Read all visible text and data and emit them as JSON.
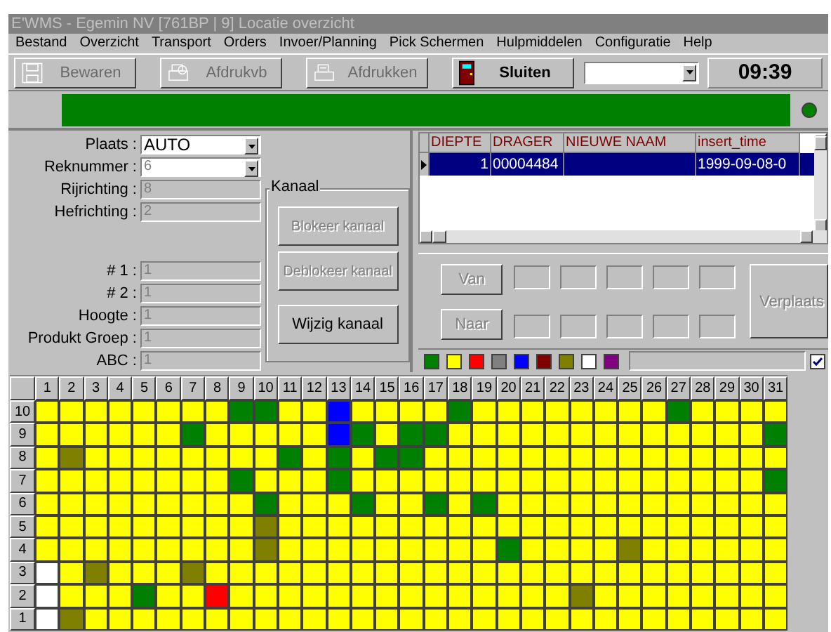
{
  "window": {
    "title": "E'WMS - Egemin NV [761BP | 9] Locatie overzicht"
  },
  "menu": [
    "Bestand",
    "Overzicht",
    "Transport",
    "Orders",
    "Invoer/Planning",
    "Pick Schermen",
    "Hulpmiddelen",
    "Configuratie",
    "Help"
  ],
  "toolbar": [
    {
      "kind": "save",
      "label": "Bewaren",
      "disabled": true
    },
    {
      "kind": "preview",
      "label": "Afdrukvb",
      "disabled": true
    },
    {
      "kind": "print",
      "label": "Afdrukken",
      "disabled": true
    },
    {
      "kind": "exit",
      "label": "Sluiten",
      "disabled": false
    }
  ],
  "clock": "09:39",
  "fields_top": [
    {
      "kind": "dropdown",
      "label": "Plaats :",
      "value": "AUTO",
      "disabled": false
    },
    {
      "kind": "dropdown",
      "label": "Reknummer :",
      "value": "6",
      "disabled": true
    },
    {
      "kind": "text",
      "label": "Rijrichting :",
      "value": "8",
      "disabled": true
    },
    {
      "kind": "text",
      "label": "Hefrichting :",
      "value": "2",
      "disabled": true
    }
  ],
  "fields_bottom": [
    {
      "kind": "text",
      "label": "# 1 :",
      "value": "1",
      "disabled": true
    },
    {
      "kind": "text",
      "label": "# 2 :",
      "value": "1",
      "disabled": true
    },
    {
      "kind": "text",
      "label": "Hoogte :",
      "value": "1",
      "disabled": true
    },
    {
      "kind": "text",
      "label": "Produkt Groep :",
      "value": "1",
      "disabled": true
    },
    {
      "kind": "text",
      "label": "ABC :",
      "value": "1",
      "disabled": true
    }
  ],
  "kanaal": {
    "title": "Kanaal",
    "buttons": [
      {
        "label": "Blokeer kanaal",
        "disabled": true
      },
      {
        "label": "Deblokeer kanaal",
        "disabled": true
      },
      {
        "label": "Wijzig kanaal",
        "disabled": false
      }
    ]
  },
  "table": {
    "columns": [
      "DIEPTE",
      "DRAGER",
      "NIEUWE NAAM",
      "insert_time"
    ],
    "rows": [
      {
        "selected": true,
        "diepte": "1",
        "drager": "00004484",
        "insert_time": "1999-09-08-0"
      }
    ]
  },
  "move": {
    "van": {
      "label": "Van",
      "disabled": true
    },
    "naar": {
      "label": "Naar",
      "disabled": true
    },
    "verplaats": {
      "label": "Verplaats",
      "disabled": true
    }
  },
  "legend": [
    {
      "color": "#008000"
    },
    {
      "color": "#ffff00"
    },
    {
      "color": "#ff0000"
    },
    {
      "color": "#808080"
    },
    {
      "color": "#0000ff"
    },
    {
      "color": "#800000"
    },
    {
      "color": "#808000"
    },
    {
      "color": "#ffffff"
    },
    {
      "color": "#800080"
    }
  ],
  "legend_checkbox": {
    "checked": true
  },
  "grid": {
    "columns": [
      "1",
      "2",
      "3",
      "4",
      "5",
      "6",
      "7",
      "8",
      "9",
      "10",
      "11",
      "12",
      "13",
      "14",
      "15",
      "16",
      "17",
      "18",
      "19",
      "20",
      "21",
      "22",
      "23",
      "24",
      "25",
      "26",
      "27",
      "28",
      "29",
      "30",
      "31"
    ],
    "rows": [
      {
        "label": "10",
        "cells": [
          {
            "color": "#ffff00"
          },
          {
            "color": "#ffff00"
          },
          {
            "color": "#ffff00"
          },
          {
            "color": "#ffff00"
          },
          {
            "color": "#ffff00"
          },
          {
            "color": "#ffff00"
          },
          {
            "color": "#ffff00"
          },
          {
            "color": "#ffff00"
          },
          {
            "color": "#008000"
          },
          {
            "color": "#008000"
          },
          {
            "color": "#ffff00"
          },
          {
            "color": "#ffff00"
          },
          {
            "color": "#0000ff"
          },
          {
            "color": "#ffff00"
          },
          {
            "color": "#ffff00"
          },
          {
            "color": "#ffff00"
          },
          {
            "color": "#ffff00"
          },
          {
            "color": "#008000"
          },
          {
            "color": "#ffff00"
          },
          {
            "color": "#ffff00"
          },
          {
            "color": "#ffff00"
          },
          {
            "color": "#ffff00"
          },
          {
            "color": "#ffff00"
          },
          {
            "color": "#ffff00"
          },
          {
            "color": "#ffff00"
          },
          {
            "color": "#ffff00"
          },
          {
            "color": "#008000"
          },
          {
            "color": "#ffff00"
          },
          {
            "color": "#ffff00"
          },
          {
            "color": "#ffff00"
          },
          {
            "color": "#ffff00"
          }
        ]
      },
      {
        "label": "9",
        "cells": [
          {
            "color": "#ffff00"
          },
          {
            "color": "#ffff00"
          },
          {
            "color": "#ffff00"
          },
          {
            "color": "#ffff00"
          },
          {
            "color": "#ffff00"
          },
          {
            "color": "#ffff00"
          },
          {
            "color": "#008000"
          },
          {
            "color": "#ffff00"
          },
          {
            "color": "#ffff00"
          },
          {
            "color": "#ffff00"
          },
          {
            "color": "#ffff00"
          },
          {
            "color": "#ffff00"
          },
          {
            "color": "#0000ff"
          },
          {
            "color": "#008000"
          },
          {
            "color": "#ffff00"
          },
          {
            "color": "#008000"
          },
          {
            "color": "#008000"
          },
          {
            "color": "#ffff00"
          },
          {
            "color": "#ffff00"
          },
          {
            "color": "#ffff00"
          },
          {
            "color": "#ffff00"
          },
          {
            "color": "#ffff00"
          },
          {
            "color": "#ffff00"
          },
          {
            "color": "#ffff00"
          },
          {
            "color": "#ffff00"
          },
          {
            "color": "#ffff00"
          },
          {
            "color": "#ffff00"
          },
          {
            "color": "#ffff00"
          },
          {
            "color": "#ffff00"
          },
          {
            "color": "#ffff00"
          },
          {
            "color": "#008000"
          }
        ]
      },
      {
        "label": "8",
        "cells": [
          {
            "color": "#ffff00"
          },
          {
            "color": "#808000"
          },
          {
            "color": "#ffff00"
          },
          {
            "color": "#ffff00"
          },
          {
            "color": "#ffff00"
          },
          {
            "color": "#ffff00"
          },
          {
            "color": "#ffff00"
          },
          {
            "color": "#ffff00"
          },
          {
            "color": "#ffff00"
          },
          {
            "color": "#ffff00"
          },
          {
            "color": "#008000"
          },
          {
            "color": "#ffff00"
          },
          {
            "color": "#008000"
          },
          {
            "color": "#ffff00"
          },
          {
            "color": "#008000"
          },
          {
            "color": "#008000"
          },
          {
            "color": "#ffff00"
          },
          {
            "color": "#ffff00"
          },
          {
            "color": "#ffff00"
          },
          {
            "color": "#ffff00"
          },
          {
            "color": "#ffff00"
          },
          {
            "color": "#ffff00"
          },
          {
            "color": "#ffff00"
          },
          {
            "color": "#ffff00"
          },
          {
            "color": "#ffff00"
          },
          {
            "color": "#ffff00"
          },
          {
            "color": "#ffff00"
          },
          {
            "color": "#ffff00"
          },
          {
            "color": "#ffff00"
          },
          {
            "color": "#ffff00"
          },
          {
            "color": "#ffff00"
          }
        ]
      },
      {
        "label": "7",
        "cells": [
          {
            "color": "#ffff00"
          },
          {
            "color": "#ffff00"
          },
          {
            "color": "#ffff00"
          },
          {
            "color": "#ffff00"
          },
          {
            "color": "#ffff00"
          },
          {
            "color": "#ffff00"
          },
          {
            "color": "#ffff00"
          },
          {
            "color": "#ffff00"
          },
          {
            "color": "#008000"
          },
          {
            "color": "#ffff00"
          },
          {
            "color": "#ffff00"
          },
          {
            "color": "#ffff00"
          },
          {
            "color": "#008000"
          },
          {
            "color": "#ffff00"
          },
          {
            "color": "#ffff00"
          },
          {
            "color": "#ffff00"
          },
          {
            "color": "#ffff00"
          },
          {
            "color": "#ffff00"
          },
          {
            "color": "#ffff00"
          },
          {
            "color": "#ffff00"
          },
          {
            "color": "#ffff00"
          },
          {
            "color": "#ffff00"
          },
          {
            "color": "#ffff00"
          },
          {
            "color": "#ffff00"
          },
          {
            "color": "#ffff00"
          },
          {
            "color": "#ffff00"
          },
          {
            "color": "#ffff00"
          },
          {
            "color": "#ffff00"
          },
          {
            "color": "#ffff00"
          },
          {
            "color": "#ffff00"
          },
          {
            "color": "#008000"
          }
        ]
      },
      {
        "label": "6",
        "cells": [
          {
            "color": "#ffff00"
          },
          {
            "color": "#ffff00"
          },
          {
            "color": "#ffff00"
          },
          {
            "color": "#ffff00"
          },
          {
            "color": "#ffff00"
          },
          {
            "color": "#ffff00"
          },
          {
            "color": "#ffff00"
          },
          {
            "color": "#ffff00"
          },
          {
            "color": "#ffff00"
          },
          {
            "color": "#008000"
          },
          {
            "color": "#ffff00"
          },
          {
            "color": "#ffff00"
          },
          {
            "color": "#ffff00"
          },
          {
            "color": "#008000"
          },
          {
            "color": "#ffff00"
          },
          {
            "color": "#ffff00"
          },
          {
            "color": "#008000"
          },
          {
            "color": "#ffff00"
          },
          {
            "color": "#008000"
          },
          {
            "color": "#ffff00"
          },
          {
            "color": "#ffff00"
          },
          {
            "color": "#ffff00"
          },
          {
            "color": "#ffff00"
          },
          {
            "color": "#ffff00"
          },
          {
            "color": "#ffff00"
          },
          {
            "color": "#ffff00"
          },
          {
            "color": "#ffff00"
          },
          {
            "color": "#ffff00"
          },
          {
            "color": "#ffff00"
          },
          {
            "color": "#ffff00"
          },
          {
            "color": "#ffff00"
          }
        ]
      },
      {
        "label": "5",
        "cells": [
          {
            "color": "#ffff00"
          },
          {
            "color": "#ffff00"
          },
          {
            "color": "#ffff00"
          },
          {
            "color": "#ffff00"
          },
          {
            "color": "#ffff00"
          },
          {
            "color": "#ffff00"
          },
          {
            "color": "#ffff00"
          },
          {
            "color": "#ffff00"
          },
          {
            "color": "#ffff00"
          },
          {
            "color": "#808000"
          },
          {
            "color": "#ffff00"
          },
          {
            "color": "#ffff00"
          },
          {
            "color": "#ffff00"
          },
          {
            "color": "#ffff00"
          },
          {
            "color": "#ffff00"
          },
          {
            "color": "#ffff00"
          },
          {
            "color": "#ffff00"
          },
          {
            "color": "#ffff00"
          },
          {
            "color": "#ffff00"
          },
          {
            "color": "#ffff00"
          },
          {
            "color": "#ffff00"
          },
          {
            "color": "#ffff00"
          },
          {
            "color": "#ffff00"
          },
          {
            "color": "#ffff00"
          },
          {
            "color": "#ffff00"
          },
          {
            "color": "#ffff00"
          },
          {
            "color": "#ffff00"
          },
          {
            "color": "#ffff00"
          },
          {
            "color": "#ffff00"
          },
          {
            "color": "#ffff00"
          },
          {
            "color": "#ffff00"
          }
        ]
      },
      {
        "label": "4",
        "cells": [
          {
            "color": "#ffff00"
          },
          {
            "color": "#ffff00"
          },
          {
            "color": "#ffff00"
          },
          {
            "color": "#ffff00"
          },
          {
            "color": "#ffff00"
          },
          {
            "color": "#ffff00"
          },
          {
            "color": "#ffff00"
          },
          {
            "color": "#ffff00"
          },
          {
            "color": "#ffff00"
          },
          {
            "color": "#808000"
          },
          {
            "color": "#ffff00"
          },
          {
            "color": "#ffff00"
          },
          {
            "color": "#ffff00"
          },
          {
            "color": "#ffff00"
          },
          {
            "color": "#ffff00"
          },
          {
            "color": "#ffff00"
          },
          {
            "color": "#ffff00"
          },
          {
            "color": "#ffff00"
          },
          {
            "color": "#ffff00"
          },
          {
            "color": "#008000"
          },
          {
            "color": "#ffff00"
          },
          {
            "color": "#ffff00"
          },
          {
            "color": "#ffff00"
          },
          {
            "color": "#ffff00"
          },
          {
            "color": "#808000"
          },
          {
            "color": "#ffff00"
          },
          {
            "color": "#ffff00"
          },
          {
            "color": "#ffff00"
          },
          {
            "color": "#ffff00"
          },
          {
            "color": "#ffff00"
          },
          {
            "color": "#ffff00"
          }
        ]
      },
      {
        "label": "3",
        "cells": [
          {
            "color": "#ffffff"
          },
          {
            "color": "#ffff00"
          },
          {
            "color": "#808000"
          },
          {
            "color": "#ffff00"
          },
          {
            "color": "#ffff00"
          },
          {
            "color": "#ffff00"
          },
          {
            "color": "#808000"
          },
          {
            "color": "#ffff00"
          },
          {
            "color": "#ffff00"
          },
          {
            "color": "#ffff00"
          },
          {
            "color": "#ffff00"
          },
          {
            "color": "#ffff00"
          },
          {
            "color": "#ffff00"
          },
          {
            "color": "#ffff00"
          },
          {
            "color": "#ffff00"
          },
          {
            "color": "#ffff00"
          },
          {
            "color": "#ffff00"
          },
          {
            "color": "#ffff00"
          },
          {
            "color": "#ffff00"
          },
          {
            "color": "#ffff00"
          },
          {
            "color": "#ffff00"
          },
          {
            "color": "#ffff00"
          },
          {
            "color": "#ffff00"
          },
          {
            "color": "#ffff00"
          },
          {
            "color": "#ffff00"
          },
          {
            "color": "#ffff00"
          },
          {
            "color": "#ffff00"
          },
          {
            "color": "#ffff00"
          },
          {
            "color": "#ffff00"
          },
          {
            "color": "#ffff00"
          },
          {
            "color": "#ffff00"
          }
        ]
      },
      {
        "label": "2",
        "cells": [
          {
            "color": "#ffffff"
          },
          {
            "color": "#ffff00"
          },
          {
            "color": "#ffff00"
          },
          {
            "color": "#ffff00"
          },
          {
            "color": "#008000"
          },
          {
            "color": "#ffff00"
          },
          {
            "color": "#ffff00"
          },
          {
            "color": "#ff0000"
          },
          {
            "color": "#ffff00"
          },
          {
            "color": "#ffff00"
          },
          {
            "color": "#ffff00"
          },
          {
            "color": "#ffff00"
          },
          {
            "color": "#ffff00"
          },
          {
            "color": "#ffff00"
          },
          {
            "color": "#ffff00"
          },
          {
            "color": "#ffff00"
          },
          {
            "color": "#ffff00"
          },
          {
            "color": "#ffff00"
          },
          {
            "color": "#ffff00"
          },
          {
            "color": "#ffff00"
          },
          {
            "color": "#ffff00"
          },
          {
            "color": "#ffff00"
          },
          {
            "color": "#808000"
          },
          {
            "color": "#ffff00"
          },
          {
            "color": "#ffff00"
          },
          {
            "color": "#ffff00"
          },
          {
            "color": "#ffff00"
          },
          {
            "color": "#ffff00"
          },
          {
            "color": "#ffff00"
          },
          {
            "color": "#ffff00"
          },
          {
            "color": "#ffff00"
          }
        ]
      },
      {
        "label": "1",
        "cells": [
          {
            "color": "#ffffff"
          },
          {
            "color": "#808000"
          },
          {
            "color": "#ffff00"
          },
          {
            "color": "#ffff00"
          },
          {
            "color": "#ffff00"
          },
          {
            "color": "#ffff00"
          },
          {
            "color": "#ffff00"
          },
          {
            "color": "#ffff00"
          },
          {
            "color": "#ffff00"
          },
          {
            "color": "#ffff00"
          },
          {
            "color": "#ffff00"
          },
          {
            "color": "#ffff00"
          },
          {
            "color": "#ffff00"
          },
          {
            "color": "#ffff00"
          },
          {
            "color": "#ffff00"
          },
          {
            "color": "#ffff00"
          },
          {
            "color": "#ffff00"
          },
          {
            "color": "#ffff00"
          },
          {
            "color": "#ffff00"
          },
          {
            "color": "#ffff00"
          },
          {
            "color": "#ffff00"
          },
          {
            "color": "#ffff00"
          },
          {
            "color": "#ffff00"
          },
          {
            "color": "#ffff00"
          },
          {
            "color": "#ffff00"
          },
          {
            "color": "#ffff00"
          },
          {
            "color": "#ffff00"
          },
          {
            "color": "#ffff00"
          },
          {
            "color": "#ffff00"
          },
          {
            "color": "#ffff00"
          },
          {
            "color": "#ffff00"
          }
        ]
      }
    ]
  }
}
